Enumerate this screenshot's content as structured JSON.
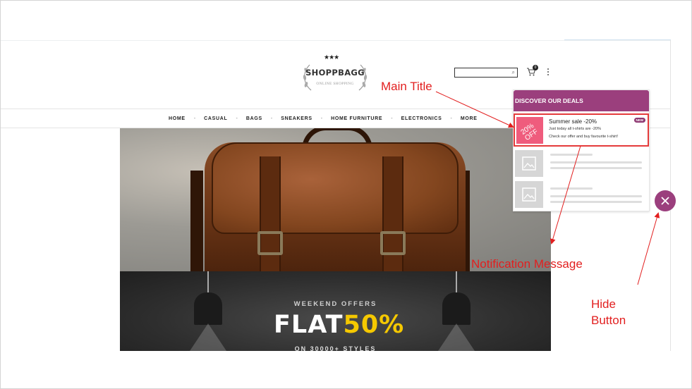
{
  "site": {
    "logo": {
      "stars": "★★★",
      "name": "SHOPPBAGG",
      "tagline": "ONLINE SHOPPING"
    },
    "cart_count": "0",
    "nav": [
      "HOME",
      "CASUAL",
      "BAGS",
      "SNEAKERS",
      "HOME FURNITURE",
      "ELECTRONICS",
      "MORE"
    ],
    "nav_separator": "-"
  },
  "banner": {
    "kicker": "WEEKEND OFFERS",
    "headline_white": "FLAT",
    "headline_yellow": "50%",
    "sub": "ON 30000+ STYLES"
  },
  "deals": {
    "title": "DISCOVER OUR DEALS",
    "item": {
      "badge": "20% OFF",
      "title": "Summer sale -20%",
      "line1": "Just today all t-shirts are -20%",
      "line2": "Check our offer and buy favourite t-shirt!",
      "tag": "NEW"
    }
  },
  "annotations": {
    "main_title": "Main Title",
    "notification": "Notification Message",
    "hide_line1": "Hide",
    "hide_line2": "Button"
  },
  "colors": {
    "accent": "#9b3f7d",
    "badge": "#ef5c7d",
    "annotation": "#e21f1f",
    "highlight_yellow": "#f5c800"
  }
}
